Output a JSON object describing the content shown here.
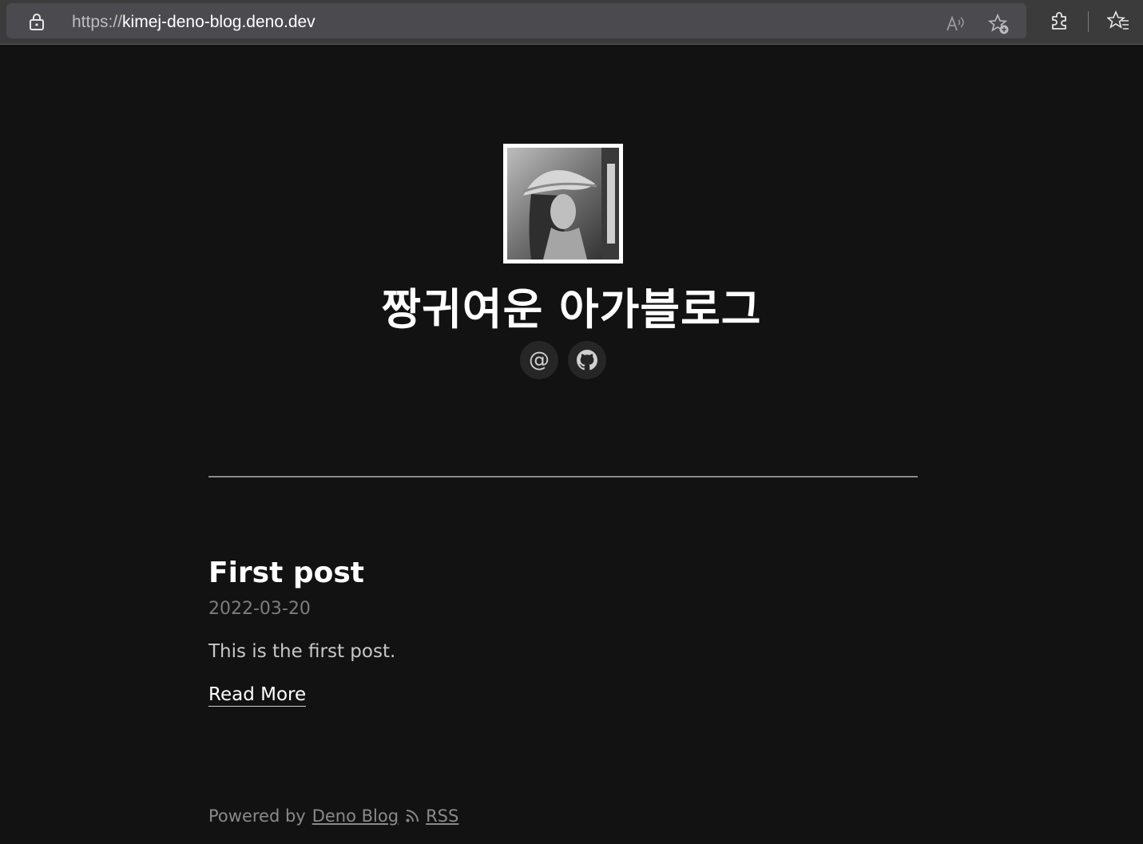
{
  "browser": {
    "url_scheme": "https://",
    "url_host": "kimej-deno-blog.deno.dev",
    "icons": [
      "lock-icon",
      "read-aloud-icon",
      "add-favorite-icon",
      "extensions-icon",
      "favorites-icon"
    ]
  },
  "header": {
    "avatar_icon": "avatar-image",
    "title": "짱귀여운 아가블로그",
    "links": [
      {
        "name": "email-link",
        "icon": "at-icon",
        "glyph": "@"
      },
      {
        "name": "github-link",
        "icon": "github-icon"
      }
    ]
  },
  "posts": [
    {
      "title": "First post",
      "date": "2022-03-20",
      "snippet": "This is the first post.",
      "read_more": "Read More"
    }
  ],
  "footer": {
    "powered_by": "Powered by",
    "link_label": "Deno Blog",
    "rss_label": "RSS"
  },
  "colors": {
    "background": "#121212",
    "text": "#ffffff",
    "muted": "#8a8a8a"
  }
}
